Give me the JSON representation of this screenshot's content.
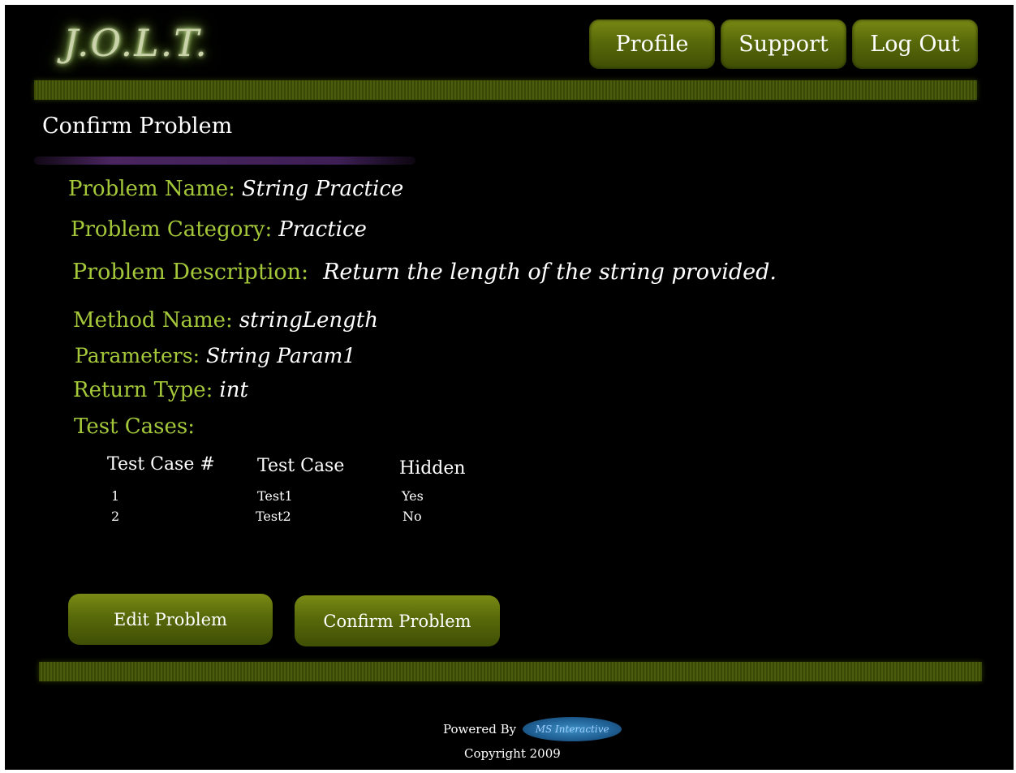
{
  "header": {
    "logo_text": "J.O.L.T.",
    "nav": {
      "profile": "Profile",
      "support": "Support",
      "logout": "Log Out"
    }
  },
  "page": {
    "title": "Confirm Problem"
  },
  "details": {
    "problem_name_label": "Problem Name:",
    "problem_name": "String Practice",
    "problem_category_label": "Problem Category:",
    "problem_category": "Practice",
    "problem_description_label": "Problem Description:",
    "problem_description": "Return the length of the string provided.",
    "method_name_label": "Method Name:",
    "method_name": "stringLength",
    "parameters_label": "Parameters:",
    "parameters": "String Param1",
    "return_type_label": "Return Type:",
    "return_type": "int",
    "test_cases_label": "Test Cases:"
  },
  "test_cases": {
    "headers": [
      "Test Case #",
      "Test Case",
      "Hidden"
    ],
    "rows": [
      [
        "1",
        "Test1",
        "Yes"
      ],
      [
        "2",
        "Test2",
        "No"
      ]
    ]
  },
  "actions": {
    "edit": "Edit Problem",
    "confirm": "Confirm Problem"
  },
  "footer": {
    "powered_by": "Powered By",
    "partner_logo": "MS Interactive",
    "copyright": "Copyright 2009"
  },
  "colors": {
    "accent_green": "#a4c83a",
    "button_green": "#58690a",
    "background": "#000000"
  }
}
